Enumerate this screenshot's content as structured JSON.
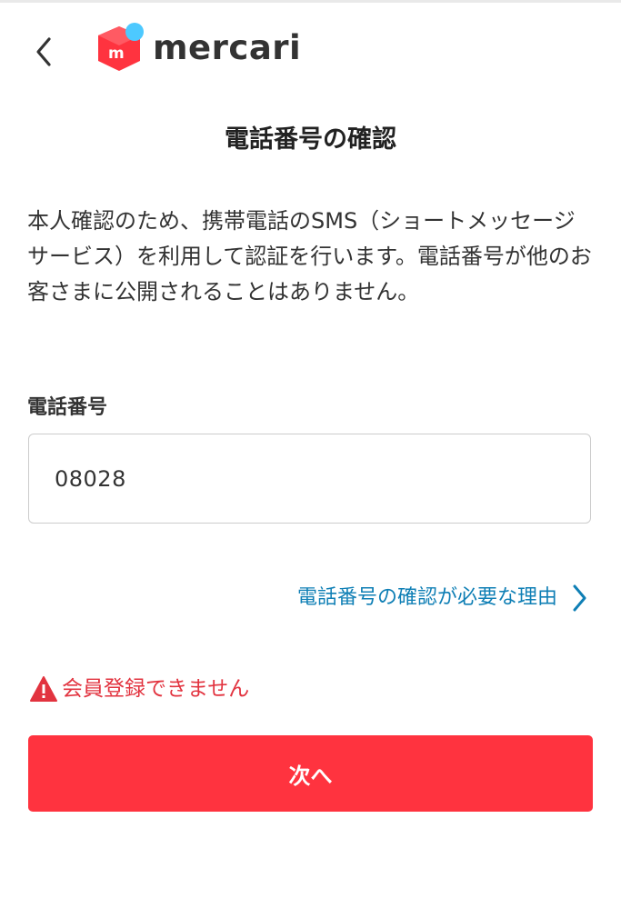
{
  "header": {
    "back_icon": "chevron-left-icon",
    "logo_icon": "mercari-logo-icon",
    "logo_text": "mercari"
  },
  "page": {
    "title": "電話番号の確認",
    "description": "本人確認のため、携帯電話のSMS（ショートメッセージサービス）を利用して認証を行います。電話番号が他のお客さまに公開されることはありません。"
  },
  "form": {
    "phone_label": "電話番号",
    "phone_value": "08028"
  },
  "why_link": {
    "label": "電話番号の確認が必要な理由",
    "icon": "chevron-right-icon"
  },
  "error": {
    "icon": "warning-icon",
    "message": "会員登録できません"
  },
  "actions": {
    "next_label": "次へ"
  },
  "colors": {
    "brand_red": "#ff333f",
    "link_blue": "#0f7fb5",
    "error_red": "#e2333f",
    "logo_blue": "#4dc9ff"
  }
}
